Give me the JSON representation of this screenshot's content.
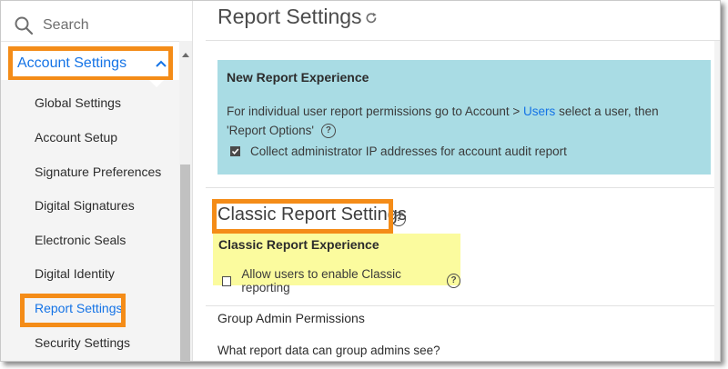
{
  "sidebar": {
    "search_placeholder": "Search",
    "section_label": "Account Settings",
    "items": [
      {
        "label": "Global Settings"
      },
      {
        "label": "Account Setup"
      },
      {
        "label": "Signature Preferences"
      },
      {
        "label": "Digital Signatures"
      },
      {
        "label": "Electronic Seals"
      },
      {
        "label": "Digital Identity"
      },
      {
        "label": "Report Settings",
        "active": true
      },
      {
        "label": "Security Settings"
      }
    ]
  },
  "main": {
    "page_title": "Report Settings",
    "new_report": {
      "title": "New Report Experience",
      "text_before_link": "For individual user report permissions go to Account > ",
      "link_text": "Users",
      "text_after_link": " select a user, then 'Report Options'",
      "checkbox_label": "Collect administrator IP addresses for account audit report",
      "checkbox_checked": true
    },
    "classic": {
      "title": "Classic Report Settings",
      "experience_title": "Classic Report Experience",
      "checkbox_label": "Allow users to enable Classic reporting",
      "checkbox_checked": false
    },
    "group_admin": {
      "title": "Group Admin Permissions",
      "question": "What report data can group admins see?"
    }
  },
  "colors": {
    "accent_blue": "#1473e6",
    "highlight_orange": "#f48c18",
    "info_box": "#a9dce4",
    "highlight_yellow": "#fbfb9e"
  }
}
